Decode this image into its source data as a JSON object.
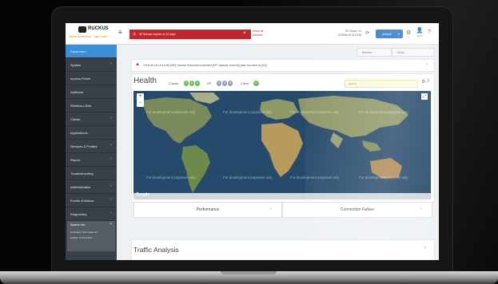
{
  "header": {
    "logo_text": "RUCKUS",
    "logo_sub": "Virtual SmartZone · High Scale",
    "menu_icon": "hamburger-icon",
    "alert_text": "AP license expires in 10 days",
    "show_all_line1": "Show all",
    "show_all_line2": "licenses",
    "cluster_line1": "SZ Cluster: 41",
    "cluster_line2": "2018/06/18 15:14:08",
    "domain_label": "default",
    "user_name": "admin"
  },
  "sidebar": {
    "items": [
      {
        "label": "Dashboard",
        "arrow": ""
      },
      {
        "label": "System",
        "arrow": "›"
      },
      {
        "label": "Access Points",
        "arrow": ""
      },
      {
        "label": "Switches",
        "arrow": ""
      },
      {
        "label": "Wireless LANs",
        "arrow": ""
      },
      {
        "label": "Clients",
        "arrow": "›"
      },
      {
        "label": "Applications",
        "arrow": ""
      },
      {
        "label": "Services & Profiles",
        "arrow": "›"
      },
      {
        "label": "Report",
        "arrow": "›"
      },
      {
        "label": "Troubleshooting",
        "arrow": ""
      },
      {
        "label": "Administration",
        "arrow": "›"
      },
      {
        "label": "Events & Alarms",
        "arrow": "›"
      },
      {
        "label": "Diagnostics",
        "arrow": "›"
      }
    ],
    "system_info": {
      "title": "System Info",
      "close": "×",
      "row1": "Hostname:  SZ-Cluster-41",
      "row2": "Version:  5.0.0.0.675"
    }
  },
  "content": {
    "crumb_left": "Refresh",
    "crumb_right": "Mode",
    "notice_text": "2018-06-18 15:14:08 [WE] License threshold exceeded [AP Capacity License] (last occurred at [41])",
    "health": {
      "title": "Health",
      "cluster_label": "Cluster",
      "cluster_counts": [
        "1",
        "0",
        "0"
      ],
      "ap_label": "AP",
      "ap_counts": [
        "0",
        "0",
        "0"
      ],
      "client_label": "Client",
      "client_count": "0",
      "select_placeholder": "Search",
      "zoom_in": "+",
      "zoom_out": "−",
      "map_watermark": "For development purposes only",
      "map_brand": "Google",
      "map_attribution": "Map data ©2018 · Terms of Use"
    },
    "tabs": [
      {
        "label": "Performance",
        "arrow": "›"
      },
      {
        "label": "Connection Failure",
        "arrow": "›"
      }
    ],
    "traffic_title": "Traffic Analysis",
    "traffic_arrow": "›"
  },
  "colors": {
    "accent": "#3b8fd6",
    "alert": "#c1272d",
    "health_good": "#6fbf5b",
    "sidebar": "#3a4047"
  }
}
